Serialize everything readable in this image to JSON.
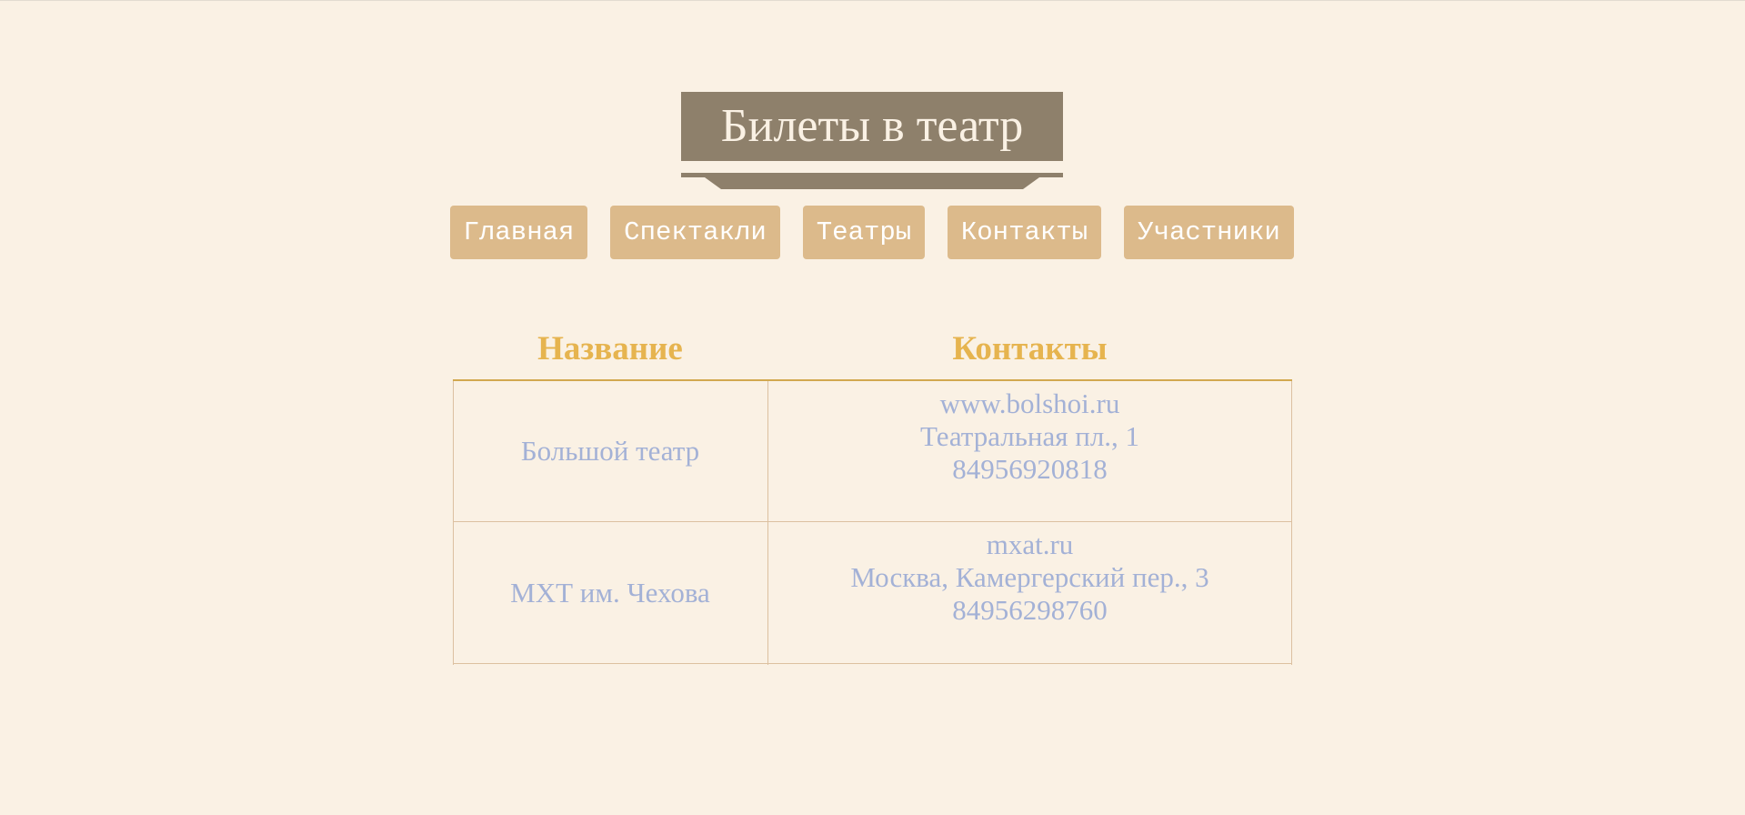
{
  "header": {
    "title": "Билеты в театр"
  },
  "nav": {
    "items": [
      {
        "label": "Главная"
      },
      {
        "label": "Спектакли"
      },
      {
        "label": "Театры"
      },
      {
        "label": "Контакты"
      },
      {
        "label": "Участники"
      }
    ]
  },
  "table": {
    "headers": {
      "name": "Название",
      "contacts": "Контакты"
    },
    "rows": [
      {
        "name": "Большой театр",
        "site": "www.bolshoi.ru",
        "address": "Театральная пл., 1",
        "phone": "84956920818"
      },
      {
        "name": "МХТ им. Чехова",
        "site": "mxat.ru",
        "address": "Москва, Камергерский пер., 3",
        "phone": "84956298760"
      }
    ]
  },
  "colors": {
    "background": "#faf1e4",
    "banner": "#8e806b",
    "nav_button": "#dcba8b",
    "header_text": "#e6b44f",
    "cell_text": "#a3b1d6",
    "grid": "#dcc0a0"
  }
}
